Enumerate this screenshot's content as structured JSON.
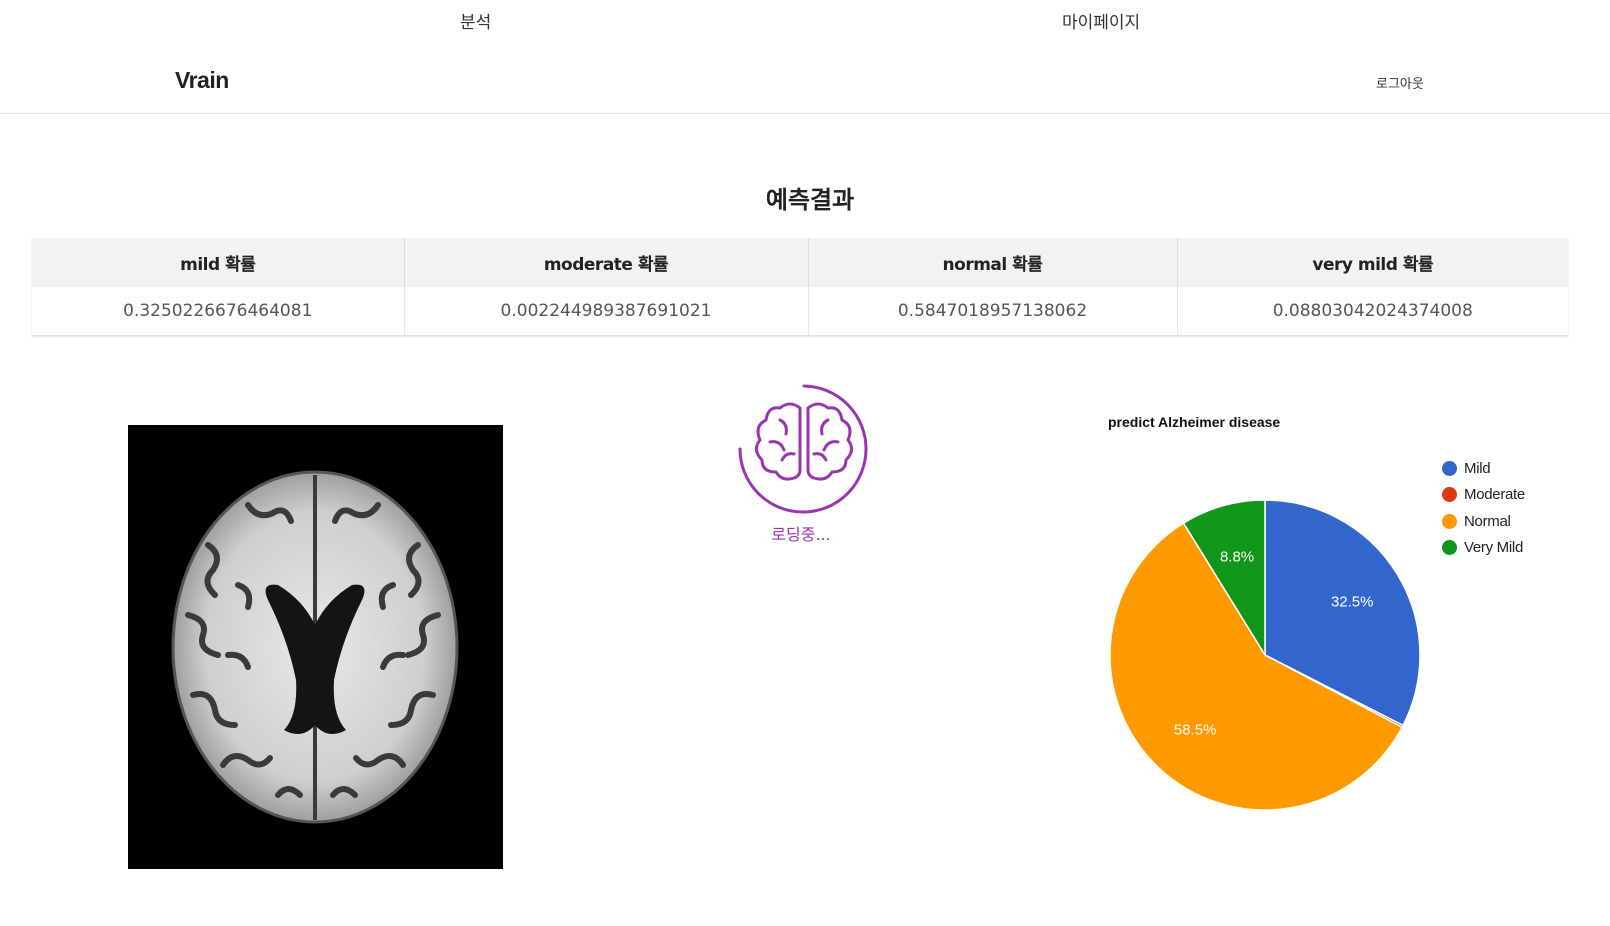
{
  "nav": {
    "analysis": "분석",
    "mypage": "마이페이지"
  },
  "header": {
    "brand": "Vrain",
    "logout": "로그아웃"
  },
  "result": {
    "title": "예측결과",
    "columns": [
      "mild 확률",
      "moderate 확률",
      "normal 확률",
      "very mild 확률"
    ],
    "values": [
      "0.3250226676464081",
      "0.002244989387691021",
      "0.5847018957138062",
      "0.08803042024374008"
    ]
  },
  "loader": {
    "label": "로딩중..."
  },
  "colors": {
    "accent": "#9a35b0",
    "mild": "#3366cc",
    "moderate": "#dc3912",
    "normal": "#ff9900",
    "very_mild": "#109618"
  },
  "icons": {
    "loader": "brain-icon"
  },
  "chart_data": {
    "type": "pie",
    "title": "predict Alzheimer disease",
    "categories": [
      "Mild",
      "Moderate",
      "Normal",
      "Very Mild"
    ],
    "values": [
      0.3250226676464081,
      0.002244989387691021,
      0.5847018957138062,
      0.08803042024374008
    ],
    "slice_labels": [
      "32.5%",
      "",
      "58.5%",
      "8.8%"
    ],
    "colors": [
      "#3366cc",
      "#dc3912",
      "#ff9900",
      "#109618"
    ],
    "legend_position": "right"
  }
}
